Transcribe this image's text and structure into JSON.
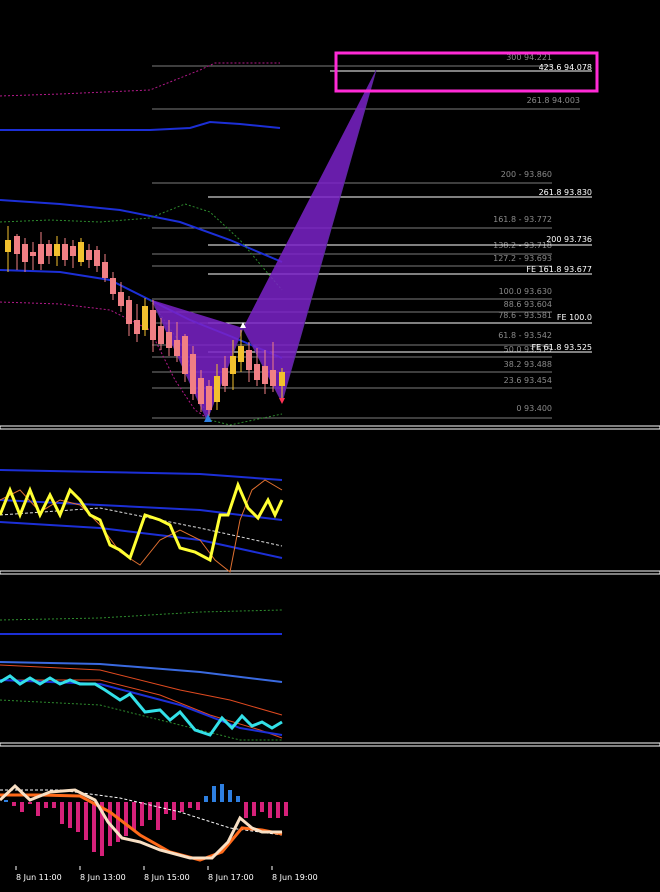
{
  "colors": {
    "background": "#000000",
    "bull_candle": "#f2c12e",
    "bear_candle": "#f07f84",
    "pattern_fill": "#7a22c8",
    "target_box": "#ff2bd6",
    "level_grey": "#7d7d7d",
    "level_white": "#ffffff",
    "pane_separator": "#ffffff",
    "bands_blue": "#1c2fd6",
    "cci_yellow": "#ffff33",
    "cyan_line": "#33e0e8",
    "histogram_magenta": "#d6217a",
    "histogram_blue": "#2e7fe0",
    "macd_line": "#f8dfc4",
    "signal_orange": "#ff6a1a"
  },
  "fib_levels_grey": [
    {
      "label": "300 94.221"
    },
    {
      "label": "261.8 94.003"
    },
    {
      "label": "200 - 93.860"
    },
    {
      "label": "161.8 -  93.772"
    },
    {
      "label": "138.2 - 93.718"
    },
    {
      "label": "127.2 - 93.693"
    },
    {
      "label": "100.0 93.630"
    },
    {
      "label": "88.6 93.604"
    },
    {
      "label": "78.6 - 93.581"
    },
    {
      "label": "61.8 - 93.542"
    },
    {
      "label": "50.0 93.515"
    },
    {
      "label": "38.2 93.488"
    },
    {
      "label": "23.6 93.454"
    },
    {
      "label": "0 93.400"
    }
  ],
  "fib_levels_white": [
    {
      "label": "423.6 94.078"
    },
    {
      "label": "261.8 93.830"
    },
    {
      "label": "200 93.736"
    },
    {
      "label": "FE 161.8 93.677"
    },
    {
      "label": "FE 100.0"
    },
    {
      "label": "FE 61.8 93.525"
    }
  ],
  "time_axis": {
    "ticks": [
      "8 Jun 11:00",
      "8 Jun 13:00",
      "8 Jun 15:00",
      "8 Jun 17:00",
      "8 Jun 19:00"
    ]
  },
  "icons": {
    "up_arrow": "up-arrow-icon",
    "up_arrow_blue": "blue-up-arrow-icon"
  }
}
